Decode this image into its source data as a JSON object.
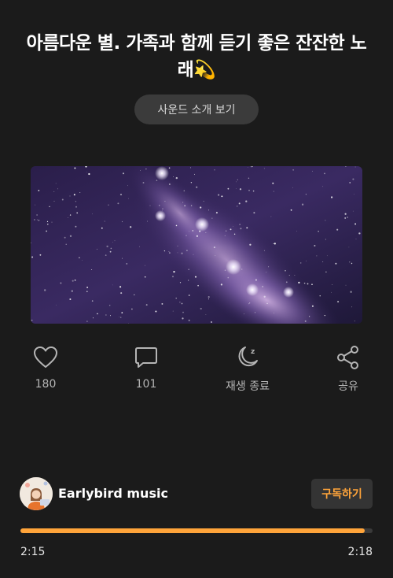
{
  "title": "아름다운 별. 가족과 함께 듣기 좋은 잔잔한 노래💫",
  "intro_button": "사운드 소개 보기",
  "actions": [
    {
      "icon": "heart-icon",
      "label": "180"
    },
    {
      "icon": "comment-icon",
      "label": "101"
    },
    {
      "icon": "sleep-timer-icon",
      "label": "재생 종료"
    },
    {
      "icon": "share-icon",
      "label": "공유"
    }
  ],
  "channel": {
    "name": "Earlybird music",
    "subscribe_label": "구독하기"
  },
  "player": {
    "current_time": "2:15",
    "total_time": "2:18",
    "progress_fraction": 0.978
  },
  "colors": {
    "background": "#1b1b1b",
    "accent": "#ffa43a",
    "button_bg": "#3b3b3b"
  }
}
